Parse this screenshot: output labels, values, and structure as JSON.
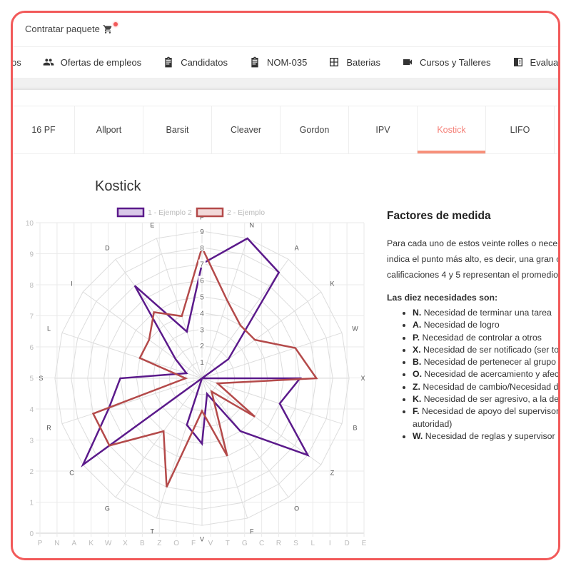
{
  "topbar": {
    "buy_label": "Contratar paquete",
    "cart_icon": "cart-icon"
  },
  "nav": {
    "items": [
      {
        "label": "os",
        "icon": ""
      },
      {
        "label": "Ofertas de empleos",
        "icon": "people-icon"
      },
      {
        "label": "Candidatos",
        "icon": "clipboard-icon"
      },
      {
        "label": "NOM-035",
        "icon": "clipboard-icon"
      },
      {
        "label": "Baterias",
        "icon": "table-icon"
      },
      {
        "label": "Cursos y Talleres",
        "icon": "video-icon"
      },
      {
        "label": "Evaluac",
        "icon": "book-icon"
      }
    ]
  },
  "tabs": [
    {
      "label": "16 PF"
    },
    {
      "label": "Allport"
    },
    {
      "label": "Barsit"
    },
    {
      "label": "Cleaver"
    },
    {
      "label": "Gordon"
    },
    {
      "label": "IPV"
    },
    {
      "label": "Kostick",
      "active": true
    },
    {
      "label": "LIFO"
    }
  ],
  "accent": "#f5827a",
  "page_title": "Kostick",
  "chart_data": {
    "type": "radar",
    "categories": [
      "P",
      "N",
      "A",
      "K",
      "W",
      "X",
      "B",
      "Z",
      "O",
      "F",
      "V",
      "T",
      "G",
      "C",
      "R",
      "S",
      "L",
      "I",
      "D",
      "E"
    ],
    "radial_ticks": [
      1,
      2,
      3,
      4,
      5,
      6,
      7,
      8,
      9
    ],
    "rmax": 9,
    "series": [
      {
        "name": "1 - Ejemplo 2",
        "color": "#5b1a8b",
        "fill": "#d9c8e8",
        "values": [
          7,
          9,
          8,
          2,
          0,
          6,
          5,
          8,
          4,
          1,
          4,
          3,
          0,
          9,
          6,
          5,
          1,
          2,
          7,
          3
        ]
      },
      {
        "name": "2 - Ejemplo",
        "color": "#b44a4a",
        "fill": "#f2d9d9",
        "values": [
          8,
          5,
          4,
          4,
          6,
          7,
          1,
          4,
          1,
          5,
          2,
          7,
          4,
          7,
          7,
          1,
          4,
          4,
          5,
          4
        ]
      }
    ],
    "background_axes": {
      "y_ticks": [
        0,
        1,
        2,
        3,
        4,
        5,
        6,
        7,
        8,
        9,
        10
      ],
      "ylim": [
        0,
        10
      ],
      "x_ticks": [
        "P",
        "N",
        "A",
        "K",
        "W",
        "X",
        "B",
        "Z",
        "O",
        "F",
        "V",
        "T",
        "G",
        "C",
        "R",
        "S",
        "L",
        "I",
        "D",
        "E"
      ]
    },
    "legend": "top"
  },
  "side": {
    "heading": "Factores de medida",
    "paragraph_lines": [
      "Para cada uno de estos veinte rolles o nece",
      "indica el punto más alto, es decir, una gran c",
      "calificaciones 4 y 5 representan el promedio"
    ],
    "subheading": "Las diez necesidades son:",
    "items": [
      {
        "key": "N.",
        "text": "Necesidad de terminar una tarea"
      },
      {
        "key": "A.",
        "text": "Necesidad de logro"
      },
      {
        "key": "P.",
        "text": "Necesidad de controlar a otros"
      },
      {
        "key": "X.",
        "text": "Necesidad de ser notificado (ser to"
      },
      {
        "key": "B.",
        "text": "Necesidad de pertenecer al grupo"
      },
      {
        "key": "O.",
        "text": "Necesidad de acercamiento y afect"
      },
      {
        "key": "Z.",
        "text": "Necesidad de cambio/Necesidad de"
      },
      {
        "key": "K.",
        "text": "Necesidad de ser agresivo, a la de"
      },
      {
        "key": "F.",
        "text": "Necesidad de apoyo del supervisor autoridad)"
      },
      {
        "key": "W.",
        "text": "Necesidad de reglas y supervisor"
      }
    ]
  }
}
